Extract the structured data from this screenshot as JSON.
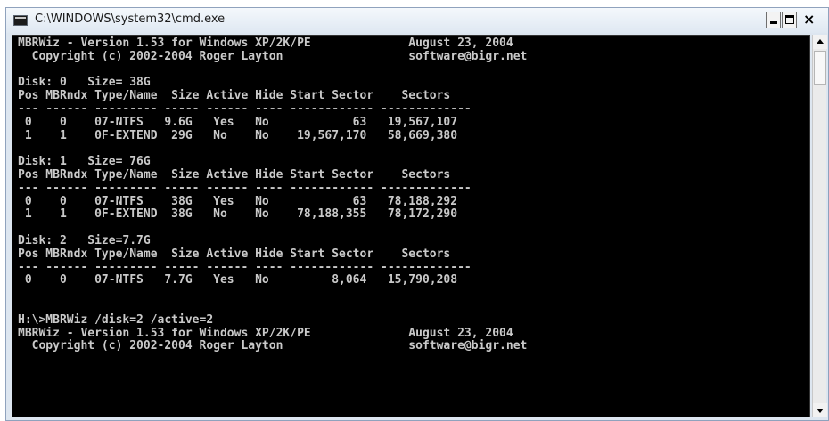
{
  "window": {
    "title": "C:\\WINDOWS\\system32\\cmd.exe",
    "icon": "cmd-console-icon",
    "controls": {
      "minimize": "minimize-icon",
      "maximize": "maximize-icon",
      "close": "×"
    }
  },
  "console": {
    "background": "#000000",
    "foreground": "#c9c9c9",
    "lines": [
      "MBRWiz - Version 1.53 for Windows XP/2K/PE              August 23, 2004",
      "  Copyright (c) 2002-2004 Roger Layton                  software@bigr.net",
      "",
      "Disk: 0   Size= 38G",
      "Pos MBRndx Type/Name  Size Active Hide Start Sector    Sectors",
      "--- ------ --------- ----- ------ ---- ------------ -------------",
      " 0    0    07-NTFS   9.6G   Yes   No            63   19,567,107",
      " 1    1    0F-EXTEND  29G   No    No    19,567,170   58,669,380",
      "",
      "Disk: 1   Size= 76G",
      "Pos MBRndx Type/Name  Size Active Hide Start Sector    Sectors",
      "--- ------ --------- ----- ------ ---- ------------ -------------",
      " 0    0    07-NTFS    38G   Yes   No            63   78,188,292",
      " 1    1    0F-EXTEND  38G   No    No    78,188,355   78,172,290",
      "",
      "Disk: 2   Size=7.7G",
      "Pos MBRndx Type/Name  Size Active Hide Start Sector    Sectors",
      "--- ------ --------- ----- ------ ---- ------------ -------------",
      " 0    0    07-NTFS   7.7G   Yes   No         8,064   15,790,208",
      "",
      "",
      "H:\\>MBRWiz /disk=2 /active=2",
      "MBRWiz - Version 1.53 for Windows XP/2K/PE              August 23, 2004",
      "  Copyright (c) 2002-2004 Roger Layton                  software@bigr.net"
    ]
  },
  "scrollbar": {
    "up": "scroll-up-arrow-icon",
    "down": "scroll-down-arrow-icon"
  }
}
